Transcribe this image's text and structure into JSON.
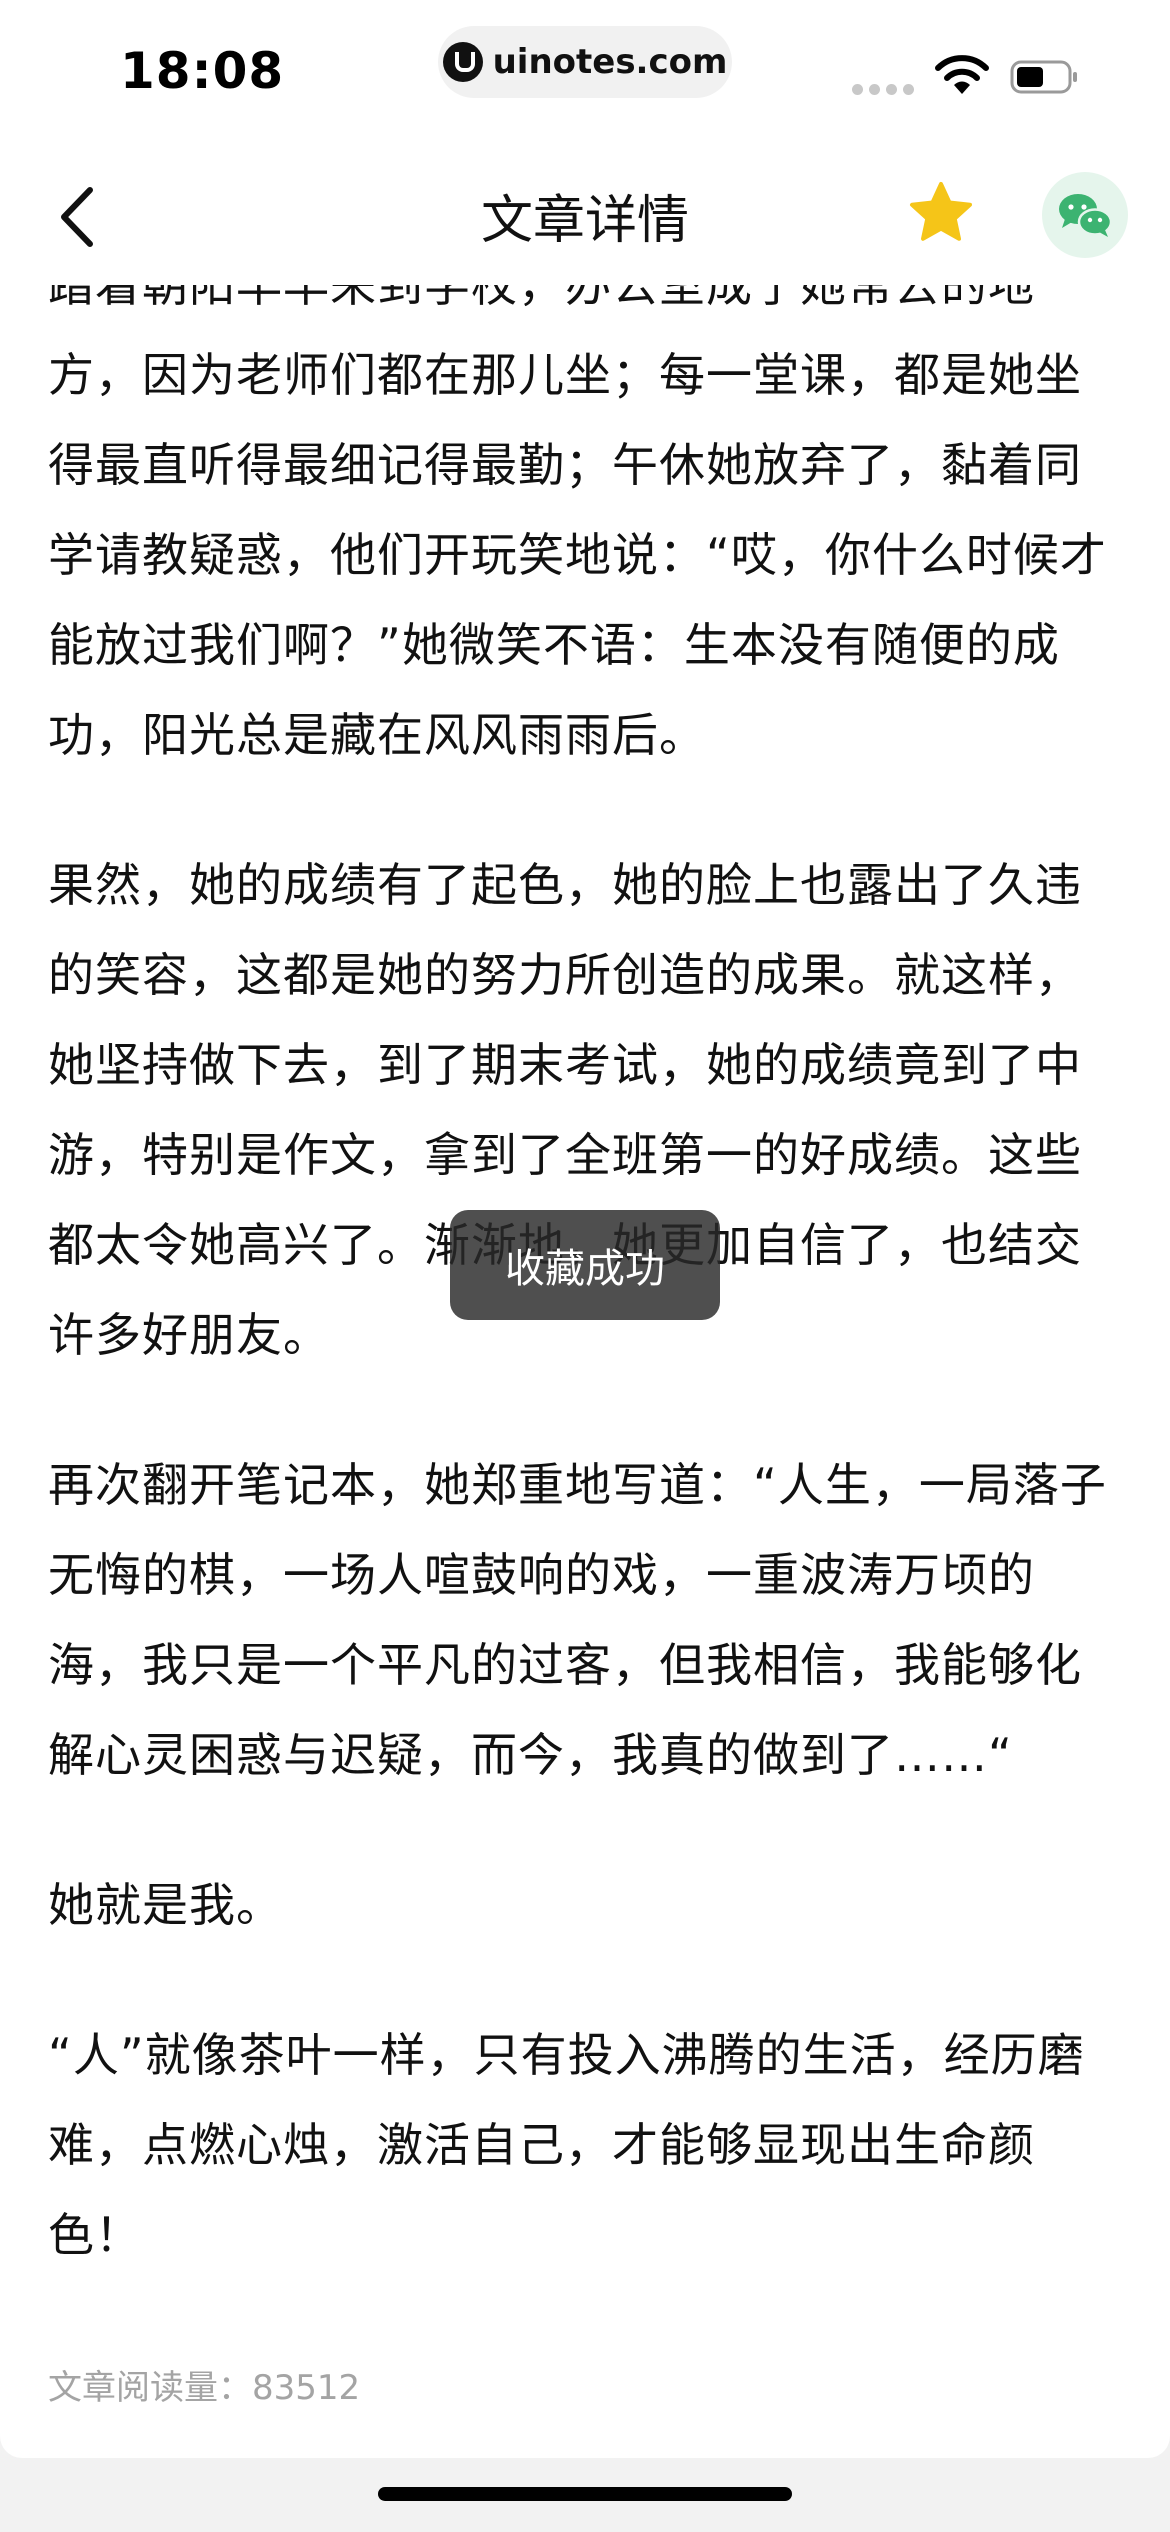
{
  "status_bar": {
    "time": "18:08",
    "url": "uinotes.com"
  },
  "nav": {
    "title": "文章详情",
    "icons": {
      "back": "chevron-left-icon",
      "favorite": "star-icon",
      "share": "wechat-icon"
    },
    "colors": {
      "star": "#F5C518",
      "wechat": "#3CB371"
    }
  },
  "article": {
    "paragraphs": [
      "踏着朝阳早早来到学校，办公室成了她常去的地方，因为老师们都在那儿坐；每一堂课，都是她坐得最直听得最细记得最勤；午休她放弃了，黏着同学请教疑惑，他们开玩笑地说：“哎，你什么时候才能放过我们啊？”她微笑不语：生本没有随便的成功，阳光总是藏在风风雨雨后。",
      "果然，她的成绩有了起色，她的脸上也露出了久违的笑容，这都是她的努力所创造的成果。就这样，她坚持做下去，到了期末考试，她的成绩竟到了中游，特别是作文，拿到了全班第一的好成绩。这些都太令她高兴了。渐渐地，她更加自信了，也结交许多好朋友。",
      "再次翻开笔记本，她郑重地写道：“人生，一局落子无悔的棋，一场人喧鼓响的戏，一重波涛万顷的海，我只是一个平凡的过客，但我相信，我能够化解心灵困惑与迟疑，而今，我真的做到了……“",
      "她就是我。",
      "“人”就像茶叶一样，只有投入沸腾的生活，经历磨难，点燃心烛，激活自己，才能够显现出生命颜色！"
    ],
    "read_count": "文章阅读量：83512"
  },
  "toast": {
    "message": "收藏成功"
  }
}
